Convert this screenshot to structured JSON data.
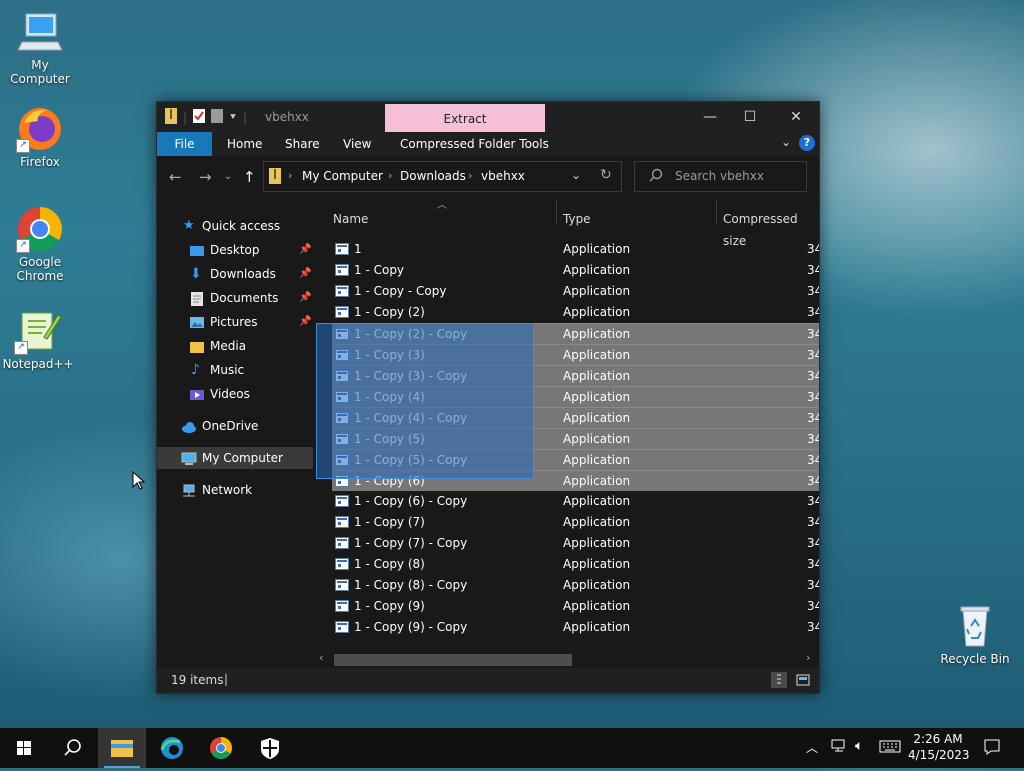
{
  "desktop": {
    "icons": [
      {
        "label": "My Computer"
      },
      {
        "label": "Firefox"
      },
      {
        "label": "Google Chrome"
      },
      {
        "label": "Notepad++"
      },
      {
        "label": "Recycle Bin"
      }
    ]
  },
  "window": {
    "title": "vbehxx",
    "context_tab": "Extract",
    "ribbon_tabs": [
      "File",
      "Home",
      "Share",
      "View",
      "Compressed Folder Tools"
    ],
    "breadcrumb": [
      "My Computer",
      "Downloads",
      "vbehxx"
    ],
    "search_placeholder": "Search vbehxx",
    "nav": [
      {
        "label": "Quick access",
        "icon": "star-icon"
      },
      {
        "label": "Desktop",
        "icon": "desktop-folder-icon",
        "pinned": true
      },
      {
        "label": "Downloads",
        "icon": "download-icon",
        "pinned": true
      },
      {
        "label": "Documents",
        "icon": "documents-icon",
        "pinned": true
      },
      {
        "label": "Pictures",
        "icon": "pictures-icon",
        "pinned": true
      },
      {
        "label": "Media",
        "icon": "folder-icon"
      },
      {
        "label": "Music",
        "icon": "music-icon"
      },
      {
        "label": "Videos",
        "icon": "videos-icon"
      },
      {
        "label": "OneDrive",
        "icon": "cloud-icon"
      },
      {
        "label": "My Computer",
        "icon": "computer-icon",
        "selected": true
      },
      {
        "label": "Network",
        "icon": "network-icon"
      }
    ],
    "columns": [
      "Name",
      "Type",
      "Compressed size"
    ],
    "files": [
      {
        "name": "1",
        "type": "Application",
        "size": "34",
        "selected": false
      },
      {
        "name": "1 - Copy",
        "type": "Application",
        "size": "34",
        "selected": false
      },
      {
        "name": "1 - Copy - Copy",
        "type": "Application",
        "size": "34",
        "selected": false
      },
      {
        "name": "1 - Copy (2)",
        "type": "Application",
        "size": "34",
        "selected": false
      },
      {
        "name": "1 - Copy (2) - Copy",
        "type": "Application",
        "size": "34",
        "selected": true
      },
      {
        "name": "1 - Copy (3)",
        "type": "Application",
        "size": "34",
        "selected": true
      },
      {
        "name": "1 - Copy (3) - Copy",
        "type": "Application",
        "size": "34",
        "selected": true
      },
      {
        "name": "1 - Copy (4)",
        "type": "Application",
        "size": "34",
        "selected": true
      },
      {
        "name": "1 - Copy (4) - Copy",
        "type": "Application",
        "size": "34",
        "selected": true
      },
      {
        "name": "1 - Copy (5)",
        "type": "Application",
        "size": "34",
        "selected": true
      },
      {
        "name": "1 - Copy (5) - Copy",
        "type": "Application",
        "size": "34",
        "selected": true
      },
      {
        "name": "1 - Copy (6)",
        "type": "Application",
        "size": "34",
        "selected": true
      },
      {
        "name": "1 - Copy (6) - Copy",
        "type": "Application",
        "size": "34",
        "selected": false
      },
      {
        "name": "1 - Copy (7)",
        "type": "Application",
        "size": "34",
        "selected": false
      },
      {
        "name": "1 - Copy (7) - Copy",
        "type": "Application",
        "size": "34",
        "selected": false
      },
      {
        "name": "1 - Copy (8)",
        "type": "Application",
        "size": "34",
        "selected": false
      },
      {
        "name": "1 - Copy (8) - Copy",
        "type": "Application",
        "size": "34",
        "selected": false
      },
      {
        "name": "1 - Copy (9)",
        "type": "Application",
        "size": "34",
        "selected": false
      },
      {
        "name": "1 - Copy (9) - Copy",
        "type": "Application",
        "size": "34",
        "selected": false
      }
    ],
    "status": "19 items"
  },
  "taskbar": {
    "time": "2:26 AM",
    "date": "4/15/2023"
  },
  "colors": {
    "accent": "#1779ba",
    "context_tab": "#f5bfd7",
    "selection": "#777777"
  }
}
